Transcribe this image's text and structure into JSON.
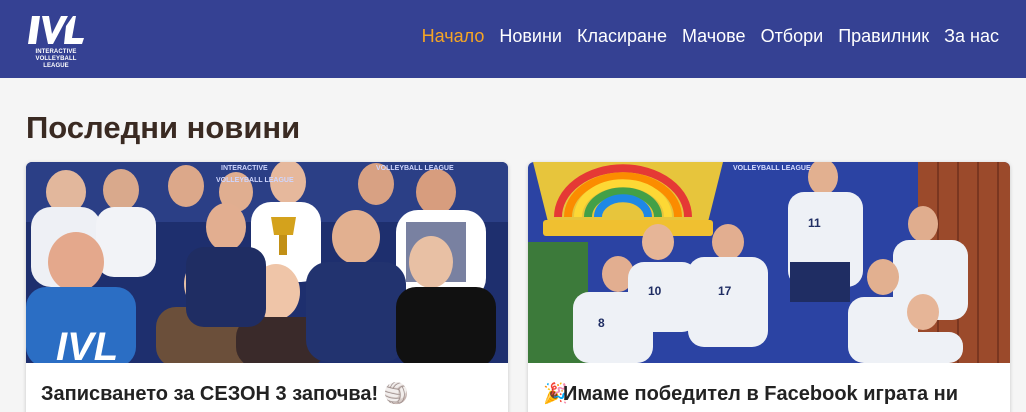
{
  "logo": {
    "mark_text": "IVL",
    "line1": "INTERACTIVE",
    "line2": "VOLLEYBALL LEAGUE"
  },
  "nav": {
    "items": [
      {
        "label": "Начало",
        "active": true
      },
      {
        "label": "Новини",
        "active": false
      },
      {
        "label": "Класиране",
        "active": false
      },
      {
        "label": "Мачове",
        "active": false
      },
      {
        "label": "Отбори",
        "active": false
      },
      {
        "label": "Правилник",
        "active": false
      },
      {
        "label": "За нас",
        "active": false
      }
    ]
  },
  "main": {
    "heading": "Последни новини",
    "cards": [
      {
        "title": "Записването за СЕЗОН 3 започва!",
        "title_suffix_icon": "volleyball-icon",
        "suffix_glyph": "🏐"
      },
      {
        "title": "Имаме победител в Facebook играта ни",
        "title_prefix_icon": "party-popper-icon",
        "prefix_glyph": "🎉"
      }
    ]
  },
  "colors": {
    "header_bg": "#354193",
    "nav_active": "#f5a524",
    "page_bg": "#f5f5f5",
    "heading_text": "#3a2a22"
  }
}
